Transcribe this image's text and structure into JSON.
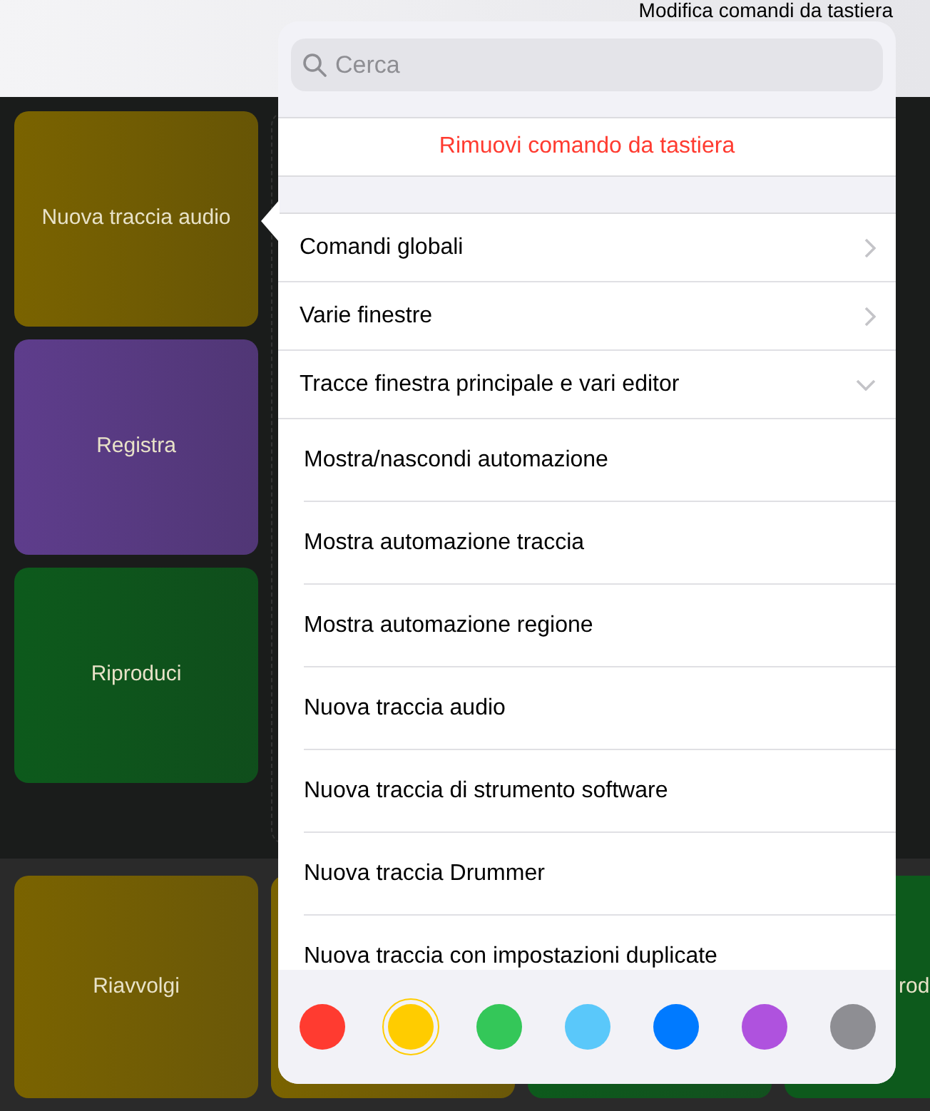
{
  "header": {
    "title": "Modifica comandi da tastiera"
  },
  "pads": [
    {
      "label": "Nuova traccia audio",
      "color": "#7a6300"
    },
    {
      "label": "Registra",
      "color": "#5e3d8c"
    },
    {
      "label": "Riproduci",
      "color": "#0d5a1c"
    }
  ],
  "bottom_pads": [
    {
      "label": "Riavvolgi",
      "color": "#7a6300"
    },
    {
      "color": "#7a6300"
    },
    {
      "color": "#0d5a1c"
    },
    {
      "label": "rod",
      "color": "#0d5a1c"
    }
  ],
  "popover": {
    "search": {
      "placeholder": "Cerca"
    },
    "remove_button": "Rimuovi comando da tastiera",
    "categories": [
      {
        "label": "Comandi globali",
        "expanded": false
      },
      {
        "label": "Varie finestre",
        "expanded": false
      },
      {
        "label": "Tracce finestra principale e vari editor",
        "expanded": true,
        "children": [
          "Mostra/nascondi automazione",
          "Mostra automazione traccia",
          "Mostra automazione regione",
          "Nuova traccia audio",
          "Nuova traccia di strumento software",
          "Nuova traccia Drummer",
          "Nuova traccia con impostazioni duplicate"
        ]
      }
    ],
    "colors": [
      {
        "color": "#ff3b30",
        "selected": false
      },
      {
        "color": "#ffcc00",
        "selected": true
      },
      {
        "color": "#34c759",
        "selected": false
      },
      {
        "color": "#5ac8fa",
        "selected": false
      },
      {
        "color": "#007aff",
        "selected": false
      },
      {
        "color": "#af52de",
        "selected": false
      },
      {
        "color": "#8e8e93",
        "selected": false
      }
    ]
  }
}
